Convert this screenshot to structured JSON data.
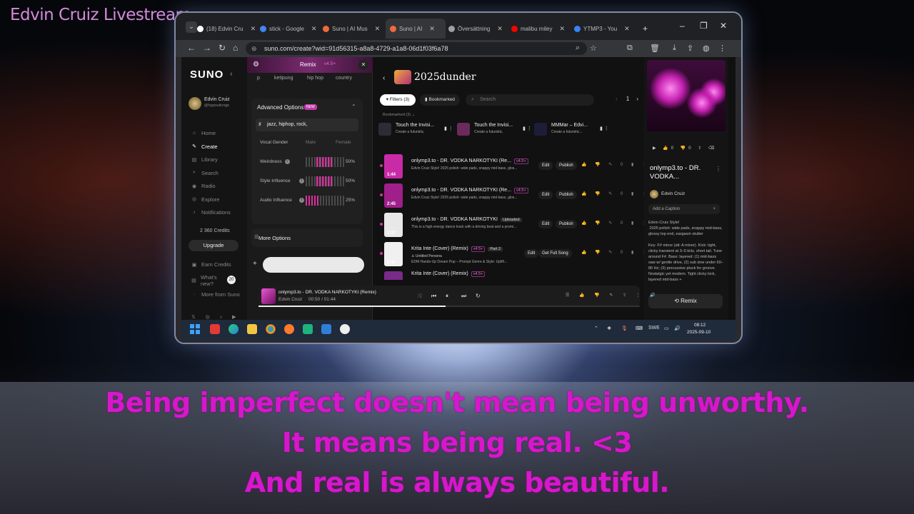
{
  "stream_title": "Edvin Cruiz Livestream",
  "browser": {
    "tabs": [
      {
        "label": "(18) Edvin Cru",
        "fav": "#ffffff"
      },
      {
        "label": "stick - Google",
        "fav": "#4285f4"
      },
      {
        "label": "Suno | AI Mus",
        "fav": "#ee6a3a"
      },
      {
        "label": "Suno | AI",
        "fav": "#ee6a3a",
        "active": true
      },
      {
        "label": "Översättning",
        "fav": "#9aa0a6"
      },
      {
        "label": "malibu miley",
        "fav": "#ff0000"
      },
      {
        "label": "YTMP3 - You",
        "fav": "#3a82f7"
      }
    ],
    "new_tab": "+",
    "url": "suno.com/create?wid=91d56315-a8a8-4729-a1a8-06d1f03f6a78"
  },
  "sidebar": {
    "logo": "SUNO",
    "user_name": "Edvin Cruiz",
    "user_handle": "@hypouticnge",
    "items": [
      {
        "label": "Home",
        "icon": "home-icon",
        "glyph": "⌂"
      },
      {
        "label": "Create",
        "icon": "create-icon",
        "glyph": "✎",
        "active": true
      },
      {
        "label": "Library",
        "icon": "library-icon",
        "glyph": "▤"
      },
      {
        "label": "Search",
        "icon": "search-icon",
        "glyph": "⌕"
      },
      {
        "label": "Radio",
        "icon": "radio-icon",
        "glyph": "◉"
      },
      {
        "label": "Explore",
        "icon": "explore-icon",
        "glyph": "◎"
      },
      {
        "label": "Notifications",
        "icon": "bell-icon",
        "glyph": "♪"
      }
    ],
    "credits": "2 360 Credits",
    "upgrade": "Upgrade",
    "earn_credits": "Earn Credits",
    "whats_new": "What's new?",
    "whats_new_badge": "20",
    "more_from_suno": "More from Suno",
    "social": "𝕏 ◎ ♪ ▶"
  },
  "panel": {
    "title": "Remix",
    "version": "v4.5+",
    "genres": [
      "p",
      "ketipung",
      "hip hop",
      "country"
    ],
    "advanced_title": "Advanced Options",
    "new_badge": "NEW",
    "style_value": "jazz, hiphop, rock,",
    "vocal_gender_label": "Vocal Gender",
    "vocal_male": "Male",
    "vocal_female": "Female",
    "sliders": [
      {
        "label": "Weirdness",
        "value": 0.5,
        "pct": "50%"
      },
      {
        "label": "Style Influence",
        "value": 0.5,
        "pct": "50%"
      },
      {
        "label": "Audio Influence",
        "value": 0.25,
        "pct": "25%"
      }
    ],
    "more_options": "More Options"
  },
  "main": {
    "workspace_title": "2025dunder",
    "filters": "Filters (3)",
    "bookmarked": "Bookmarked",
    "search_placeholder": "Search",
    "page": "1",
    "bookmarked_label": "Bookmarked (3)",
    "bookmark_cards": [
      {
        "title": "Touch the Invisi...",
        "sub": "Create a futuristic,",
        "color": "#2c2c34"
      },
      {
        "title": "Touch the Invisi...",
        "sub": "Create a futuristic,",
        "color": "#6b2a5c"
      },
      {
        "title": "MMMar – Edvi...",
        "sub": "Create a futuristic...",
        "color": "#1d1d3a"
      }
    ],
    "songs": [
      {
        "title": "onlymp3.to - DR. VODKA NARKOTYKI (Re...",
        "ver": "v4.5+",
        "tag": "",
        "desc": "Edvin Cruiz Style! 2025 polish: wide pads, snappy mid-bass, glos...",
        "dur": "1:44",
        "color": "#c92aa8",
        "edit": "Edit",
        "publish": "Publish",
        "likes": "0"
      },
      {
        "title": "onlymp3.to - DR. VODKA NARKOTYKI (Re...",
        "ver": "v4.5+",
        "tag": "",
        "desc": "Edvin Cruiz Style! 2025 polish: wide pads, snappy mid-bass, glos...",
        "dur": "2:45",
        "color": "#a01f8a",
        "edit": "Edit",
        "publish": "Publish",
        "likes": "0"
      },
      {
        "title": "onlymp3.to - DR. VODKA NARKOTYKI",
        "ver": "",
        "tag": "Uploaded",
        "desc": "This is a high-energy dance track with a driving beat and a promi...",
        "dur": "2:37",
        "color": "#e8e8e8",
        "edit": "Edit",
        "publish": "Publish",
        "likes": "0"
      },
      {
        "title": "Krita Inte (Cover) (Remix)",
        "ver": "v4.5+",
        "tag": "Part 2",
        "desc": "EDM Hands-Up Dream Pop – Prompt Genre & Style: Uplift...",
        "dur": "1:40",
        "color": "#f0f0f0",
        "edit": "Edit",
        "publish": "Get Full Song",
        "likes": "0",
        "persona": "Untitled Persona"
      },
      {
        "title": "Krita Inte (Cover) (Remix)",
        "ver": "v4.5+",
        "tag": "",
        "desc": "",
        "dur": "",
        "color": "#7a2a8a",
        "edit": "",
        "publish": "",
        "likes": ""
      }
    ]
  },
  "detail": {
    "likes": "0",
    "dislikes": "0",
    "title": "onlymp3.to - DR. VODKA...",
    "artist": "Edvin Cruiz",
    "add_caption": "Add a Caption",
    "lyrics": "Edvin Cruiz Style!\n 2025 polish: wide pads, snappy mid-bass, glossy top end, eargasm stutter\n\nKey: F# minor (alt: A minor). Kick: tight, clicky transient at 3–5 kHz, short tail. Tune around F#. Bass: layered: (1) mid-bass saw w/ gentle drive, (2) sub sine under 60–80 Hz; (3) percussive pluck for groove. Nostalgic yet modern. Tight clicky kick, layered mid-bass +",
    "remix": "Remix"
  },
  "player": {
    "title": "onlymp3.to - DR. VODKA NARKOTYKI (Remix)",
    "artist": "Edvin Cruiz",
    "time": "00:50 / 01:44",
    "progress": 0.48
  },
  "taskbar": {
    "lang": "SWE",
    "time": "08:12",
    "date": "2025-09-10"
  },
  "quote": {
    "line1": "Being imperfect doesn't mean being unworthy.",
    "line2": "It means being real. <3",
    "line3": "And real is always beautiful."
  }
}
